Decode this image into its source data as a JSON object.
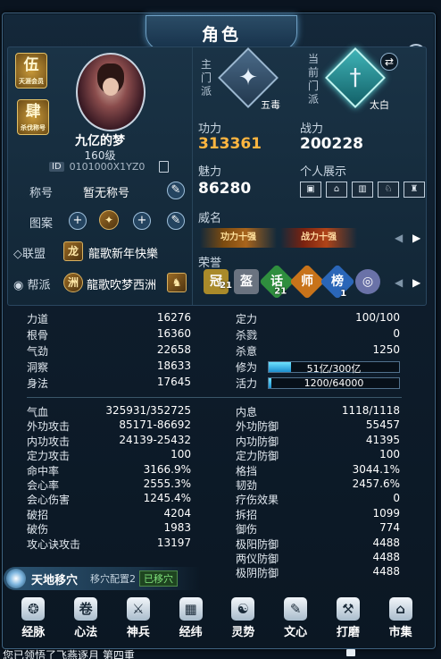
{
  "window": {
    "title": "角色",
    "close_glyph": "✕"
  },
  "badges": [
    {
      "big": "伍",
      "small": "天涯会员"
    },
    {
      "big": "肆",
      "small": "杀伐称号"
    }
  ],
  "profile": {
    "name": "九亿的梦",
    "level": "160级",
    "id_tag": "ID",
    "id_value": "0101000X1YZ0"
  },
  "left_rows": {
    "title_label": "称号",
    "title_value": "暂无称号",
    "pattern_label": "图案",
    "alliance_label": "◇联盟",
    "alliance_emblem": "龙",
    "alliance_value": "龍歌新年快樂",
    "guild_label": "帮派",
    "guild_emblem": "洲",
    "guild_value": "龍歌吹梦西洲"
  },
  "schools": {
    "main_label": [
      "主",
      "门",
      "派"
    ],
    "main_name": "五毒",
    "current_label": [
      "当",
      "前",
      "门",
      "派"
    ],
    "current_name": "太白"
  },
  "stats_top": {
    "gongli_label": "功力",
    "gongli_value": "313361",
    "zhanli_label": "战力",
    "zhanli_value": "200228",
    "meili_label": "魅力",
    "meili_value": "86280",
    "show_label": "个人展示"
  },
  "fame": {
    "label": "威名",
    "items": [
      "功力十强",
      "战力十强"
    ]
  },
  "honor": {
    "label": "荣誉",
    "items": [
      {
        "glyph": "冠",
        "count": "21",
        "color": "#a98a2a"
      },
      {
        "glyph": "盔",
        "count": "",
        "color": "#6a7380"
      },
      {
        "glyph": "话",
        "count": "21",
        "color": "#2f8e3e"
      },
      {
        "glyph": "师",
        "count": "",
        "color": "#c8731a"
      },
      {
        "glyph": "榜",
        "count": "1",
        "color": "#2a66b8"
      },
      {
        "glyph": "◎",
        "count": "",
        "color": "#6a72a8"
      }
    ]
  },
  "attr1": [
    {
      "l": "力道",
      "v": "16276",
      "l2": "定力",
      "v2": "100/100"
    },
    {
      "l": "根骨",
      "v": "16360",
      "l2": "杀戮",
      "v2": "0"
    },
    {
      "l": "气劲",
      "v": "22658",
      "l2": "杀意",
      "v2": "1250"
    },
    {
      "l": "洞察",
      "v": "18633",
      "l2": "修为",
      "bar": "51亿/300亿",
      "fill": 0.17
    },
    {
      "l": "身法",
      "v": "17645",
      "l2": "活力",
      "bar": "1200/64000",
      "fill": 0.02
    }
  ],
  "attr2": [
    {
      "l": "气血",
      "v": "325931/352725",
      "l2": "内息",
      "v2": "1118/1118"
    },
    {
      "l": "外功攻击",
      "v": "85171-86692",
      "l2": "外功防御",
      "v2": "55457"
    },
    {
      "l": "内功攻击",
      "v": "24139-25432",
      "l2": "内功防御",
      "v2": "41395"
    },
    {
      "l": "定力攻击",
      "v": "100",
      "l2": "定力防御",
      "v2": "100"
    },
    {
      "l": "命中率",
      "v": "3166.9%",
      "l2": "格挡",
      "v2": "3044.1%"
    },
    {
      "l": "会心率",
      "v": "2555.3%",
      "l2": "韧劲",
      "v2": "2457.6%"
    },
    {
      "l": "会心伤害",
      "v": "1245.4%",
      "l2": "疗伤效果",
      "v2": "0"
    },
    {
      "l": "破招",
      "v": "4204",
      "l2": "拆招",
      "v2": "1099"
    },
    {
      "l": "破伤",
      "v": "1983",
      "l2": "御伤",
      "v2": "774"
    },
    {
      "l": "攻心诀攻击",
      "v": "13197",
      "l2": "极阳防御",
      "v2": "4488"
    },
    {
      "l": "",
      "v": "",
      "l2": "两仪防御",
      "v2": "4488"
    },
    {
      "l": "",
      "v": "",
      "l2": "极阴防御",
      "v2": "4488"
    }
  ],
  "tiandi": {
    "title": "天地移穴",
    "config": "移穴配置2",
    "state": "已移穴"
  },
  "bottom_tabs": [
    {
      "label": "经脉",
      "icon": "meridian-icon",
      "glyph": "❂"
    },
    {
      "label": "心法",
      "icon": "scroll-icon",
      "glyph": "卷"
    },
    {
      "label": "神兵",
      "icon": "weapon-icon",
      "glyph": "⚔"
    },
    {
      "label": "经纬",
      "icon": "grid-icon",
      "glyph": "▦"
    },
    {
      "label": "灵势",
      "icon": "gourd-icon",
      "glyph": "☯"
    },
    {
      "label": "文心",
      "icon": "quill-icon",
      "glyph": "✎"
    },
    {
      "label": "打磨",
      "icon": "hammer-icon",
      "glyph": "⚒"
    },
    {
      "label": "市集",
      "icon": "shop-icon",
      "glyph": "⌂"
    }
  ],
  "chat": {
    "line": "您已领悟了飞燕逐月 第四重"
  },
  "colors": {
    "gold": "#ffb640",
    "bar": "#1b8fd0",
    "accent": "#6fa0c4"
  }
}
